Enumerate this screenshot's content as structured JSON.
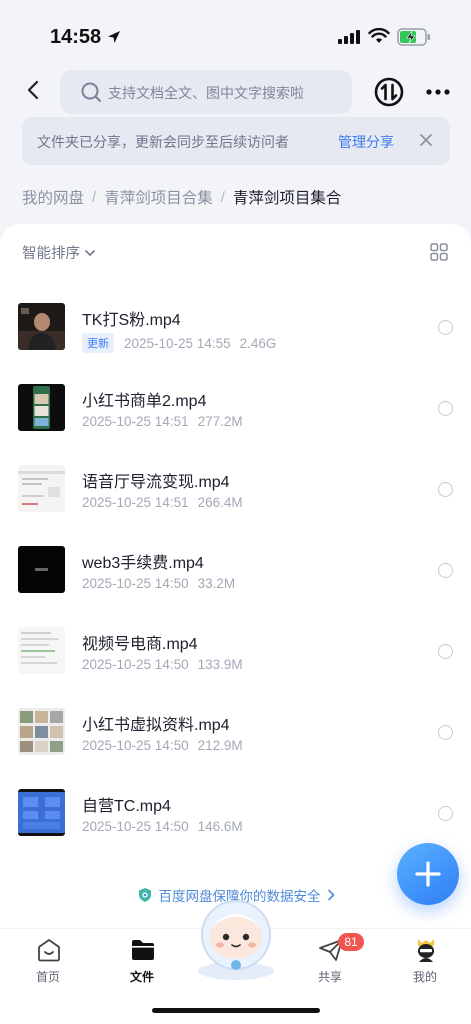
{
  "status_bar": {
    "time": "14:58"
  },
  "header": {
    "search_placeholder": "支持文档全文、图中文字搜索啦"
  },
  "notice": {
    "text": "文件夹已分享，更新会同步至后续访问者",
    "link": "管理分享"
  },
  "breadcrumb": {
    "items": [
      "我的网盘",
      "青萍剑项目合集",
      "青萍剑项目集合"
    ],
    "separator": "/"
  },
  "toolbar": {
    "sort_label": "智能排序"
  },
  "files": [
    {
      "name": "TK打S粉.mp4",
      "badge": "更新",
      "date": "2025-10-25 14:55",
      "size": "2.46G",
      "thumb": "person"
    },
    {
      "name": "小红书商单2.mp4",
      "badge": "",
      "date": "2025-10-25 14:51",
      "size": "277.2M",
      "thumb": "phone"
    },
    {
      "name": "语音厅导流变现.mp4",
      "badge": "",
      "date": "2025-10-25 14:51",
      "size": "266.4M",
      "thumb": "doc"
    },
    {
      "name": "web3手续费.mp4",
      "badge": "",
      "date": "2025-10-25 14:50",
      "size": "33.2M",
      "thumb": "black"
    },
    {
      "name": "视频号电商.mp4",
      "badge": "",
      "date": "2025-10-25 14:50",
      "size": "133.9M",
      "thumb": "page"
    },
    {
      "name": "小红书虚拟资料.mp4",
      "badge": "",
      "date": "2025-10-25 14:50",
      "size": "212.9M",
      "thumb": "grid"
    },
    {
      "name": "自营TC.mp4",
      "badge": "",
      "date": "2025-10-25 14:50",
      "size": "146.6M",
      "thumb": "blue"
    }
  ],
  "security_text": "百度网盘保障你的数据安全",
  "nav": {
    "home": "首页",
    "files": "文件",
    "share": "共享",
    "share_badge": "81",
    "mine": "我的"
  },
  "colors": {
    "accent": "#3e7bef",
    "badge_red": "#f2554f"
  }
}
